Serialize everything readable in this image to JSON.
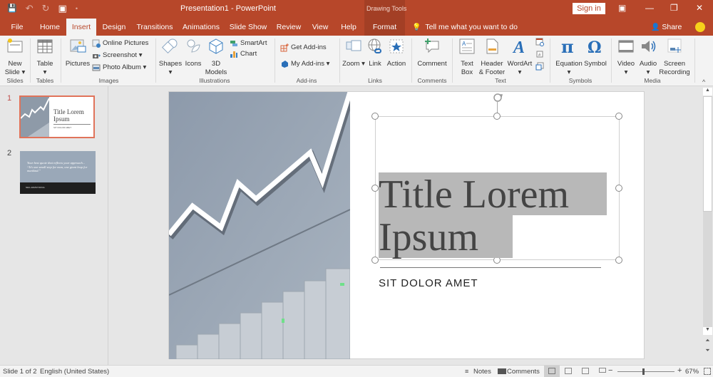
{
  "titlebar": {
    "app_title": "Presentation1  -  PowerPoint",
    "context_label": "Drawing Tools",
    "sign_in": "Sign in",
    "qat": {
      "save_icon": "💾",
      "undo_icon": "↶",
      "dropdown": "•",
      "redo_icon": "↻",
      "present_icon": "▣"
    },
    "window_buttons": {
      "ribbon_display": "▣",
      "minimize": "—",
      "restore": "❐",
      "close": "✕"
    }
  },
  "tabs": [
    {
      "label": "File"
    },
    {
      "label": "Home"
    },
    {
      "label": "Insert",
      "active": true
    },
    {
      "label": "Design"
    },
    {
      "label": "Transitions"
    },
    {
      "label": "Animations"
    },
    {
      "label": "Slide Show"
    },
    {
      "label": "Review"
    },
    {
      "label": "View"
    },
    {
      "label": "Help"
    },
    {
      "label": "Format"
    }
  ],
  "tell_me": "Tell me what you want to do",
  "tell_me_icon": "💡",
  "share": "Share",
  "share_icon": "👤",
  "ribbon": {
    "groups": {
      "slides": "Slides",
      "tables": "Tables",
      "images": "Images",
      "illustrations": "Illustrations",
      "addins": "Add-ins",
      "links": "Links",
      "comments": "Comments",
      "text": "Text",
      "symbols": "Symbols",
      "media": "Media"
    },
    "buttons": {
      "new_slide": "New Slide ▾",
      "table": "Table ▾",
      "pictures": "Pictures",
      "online_pictures": "Online Pictures",
      "screenshot": "Screenshot ▾",
      "photo_album": "Photo Album  ▾",
      "shapes": "Shapes ▾",
      "icons": "Icons",
      "models_3d": "3D Models",
      "smartart": "SmartArt",
      "chart": "Chart",
      "get_addins": "Get Add-ins",
      "my_addins": "My Add-ins  ▾",
      "zoom": "Zoom ▾",
      "link": "Link",
      "action": "Action",
      "comment": "Comment",
      "text_box": "Text Box",
      "header_footer": "Header & Footer",
      "wordart": "WordArt ▾",
      "equation": "Equation ▾",
      "symbol": "Symbol",
      "video": "Video ▾",
      "audio": "Audio ▾",
      "screen_recording": "Screen Recording"
    },
    "collapse": "^"
  },
  "thumbnails": [
    {
      "number": "1",
      "title": "Title Lorem Ipsum",
      "subtitle": "SIT DOLOR AMET"
    },
    {
      "number": "2",
      "quote": "Your best quote that reflects your approach... “It’s one small step for man, one giant leap for mankind.”",
      "author": "NEIL ARMSTRONG"
    }
  ],
  "slide": {
    "title_line1": "Title Lorem",
    "title_line2": "Ipsum",
    "subtitle": "SIT DOLOR AMET"
  },
  "status": {
    "slide_of": "Slide 1 of 2",
    "language": "English (United States)",
    "notes": "Notes",
    "comments": "Comments",
    "zoom_minus": "−",
    "zoom_plus": "+",
    "zoom_level": "67%",
    "zoom_fraction": 0.45
  },
  "colors": {
    "accent": "#b7472a",
    "selection_highlight": "#b8b8b8",
    "thumb_selected_border": "#e0735a"
  }
}
